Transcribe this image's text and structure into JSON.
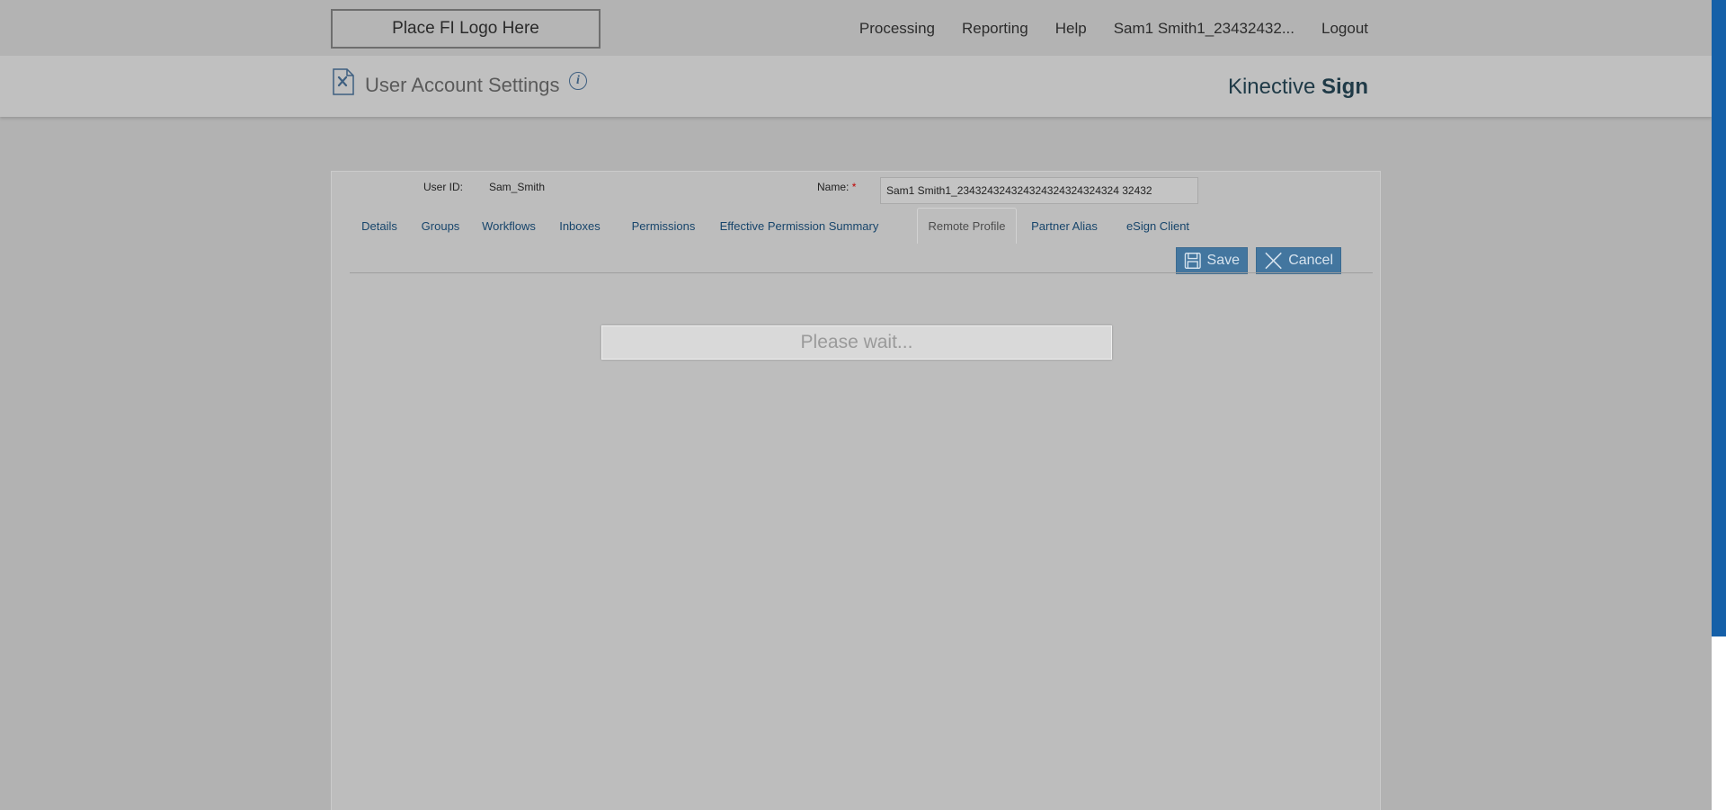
{
  "topbar": {
    "logo_text": "Place FI Logo Here",
    "nav": [
      "Processing",
      "Reporting",
      "Help",
      "Sam1 Smith1_23432432...",
      "Logout"
    ]
  },
  "header": {
    "title": "User Account Settings",
    "info_glyph": "i",
    "brand_light": "Kinective ",
    "brand_bold": "Sign"
  },
  "user": {
    "user_id_label": "User ID:",
    "user_id_value": "Sam_Smith",
    "name_label": "Name:",
    "required_mark": "*",
    "name_value": "Sam1 Smith1_234324324324324324324324324 32432"
  },
  "tabs": [
    {
      "label": "Details"
    },
    {
      "label": "Groups"
    },
    {
      "label": "Workflows"
    },
    {
      "label": "Inboxes"
    },
    {
      "label": "Permissions"
    },
    {
      "label": "Effective Permission Summary"
    },
    {
      "label": "Remote Profile",
      "active": true
    },
    {
      "label": "Partner Alias"
    },
    {
      "label": "eSign Client"
    }
  ],
  "actions": {
    "save_label": "Save",
    "cancel_label": "Cancel"
  },
  "status": {
    "wait_text": "Please wait..."
  },
  "colors": {
    "accent_button": "#43769f",
    "link": "#17456b",
    "scrollbar": "#1560a8",
    "required": "#c00000"
  },
  "icons": {
    "page": "document-settings-icon",
    "info": "info-icon",
    "save": "floppy-disk-icon",
    "cancel": "close-icon"
  }
}
